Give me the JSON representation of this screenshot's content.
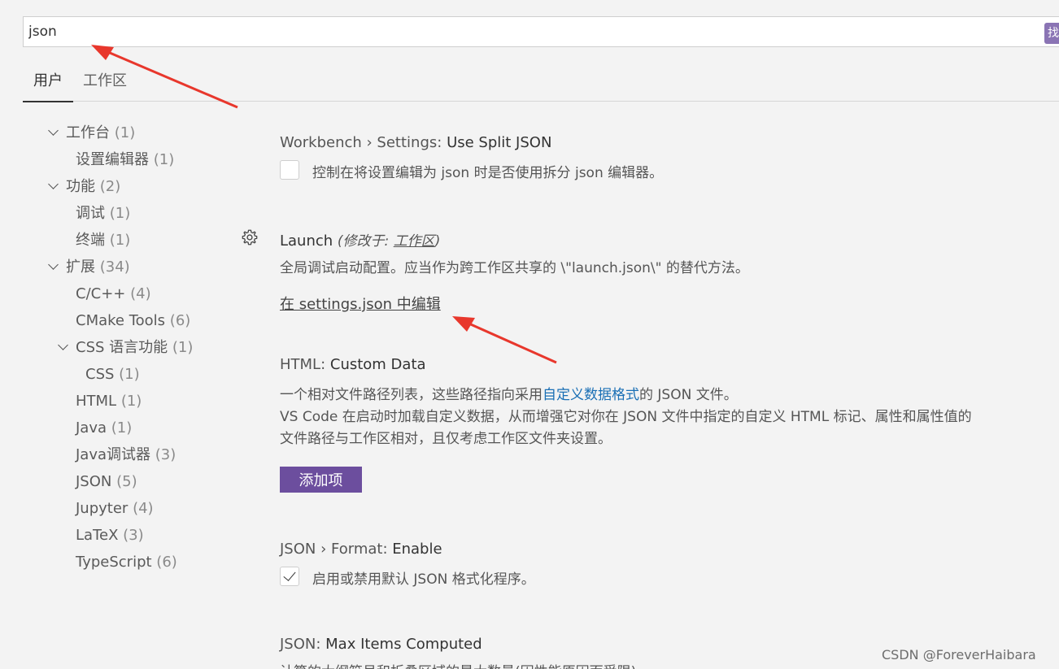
{
  "search": {
    "value": "json",
    "badge": "找"
  },
  "tabs": [
    {
      "label": "用户"
    },
    {
      "label": "工作区"
    }
  ],
  "toc": [
    {
      "label": "工作台",
      "count": "(1)"
    },
    {
      "label": "设置编辑器",
      "count": "(1)"
    },
    {
      "label": "功能",
      "count": "(2)"
    },
    {
      "label": "调试",
      "count": "(1)"
    },
    {
      "label": "终端",
      "count": "(1)"
    },
    {
      "label": "扩展",
      "count": "(34)"
    },
    {
      "label": "C/C++",
      "count": "(4)"
    },
    {
      "label": "CMake Tools",
      "count": "(6)"
    },
    {
      "label": "CSS 语言功能",
      "count": "(1)"
    },
    {
      "label": "CSS",
      "count": "(1)"
    },
    {
      "label": "HTML",
      "count": "(1)"
    },
    {
      "label": "Java",
      "count": "(1)"
    },
    {
      "label": "Java调试器",
      "count": "(3)"
    },
    {
      "label": "JSON",
      "count": "(5)"
    },
    {
      "label": "Jupyter",
      "count": "(4)"
    },
    {
      "label": "LaTeX",
      "count": "(3)"
    },
    {
      "label": "TypeScript",
      "count": "(6)"
    }
  ],
  "settings": {
    "split_json": {
      "category": "Workbench › Settings: ",
      "name": "Use Split JSON",
      "description": "控制在将设置编辑为 json 时是否使用拆分 json 编辑器。",
      "checked": false
    },
    "launch": {
      "name": "Launch",
      "modified_prefix": "(修改于: ",
      "modified_scope": "工作区",
      "modified_suffix": ")",
      "description": "全局调试启动配置。应当作为跨工作区共享的 \\\"launch.json\\\" 的替代方法。",
      "edit_link": "在 settings.json 中编辑"
    },
    "html_custom_data": {
      "category": "HTML: ",
      "name": "Custom Data",
      "desc1_pre": "一个相对文件路径列表，这些路径指向采用",
      "desc1_link": "自定义数据格式",
      "desc1_post": "的 JSON 文件。",
      "desc2": "VS Code 在启动时加载自定义数据，从而增强它对你在 JSON 文件中指定的自定义 HTML 标记、属性和属性值的",
      "desc3": "文件路径与工作区相对，且仅考虑工作区文件夹设置。",
      "add_button": "添加项"
    },
    "json_format": {
      "category": "JSON › Format: ",
      "name": "Enable",
      "description": "启用或禁用默认 JSON 格式化程序。",
      "checked": true
    },
    "json_max_items": {
      "category": "JSON: ",
      "name": "Max Items Computed",
      "description": "计算的大纲符号和折叠区域的最大数量(因性能原因而受限)。"
    }
  },
  "watermark": "CSDN @ForeverHaibara",
  "colors": {
    "accent_button": "#6c4e9e",
    "arrow": "#e8372c",
    "link": "#1a6fb5"
  }
}
